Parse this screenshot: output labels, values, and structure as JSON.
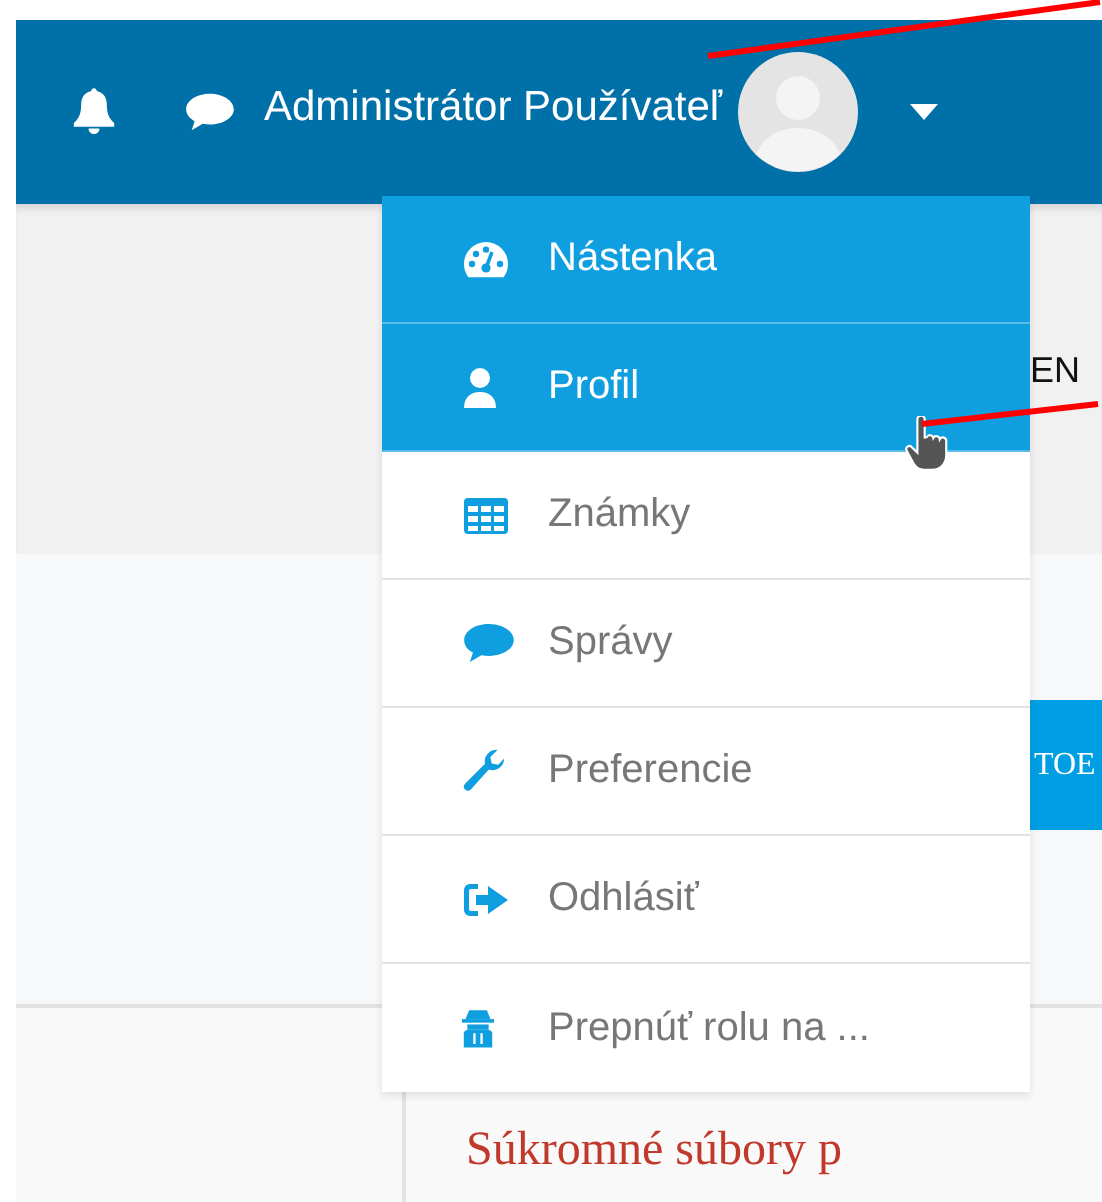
{
  "navbar": {
    "user_name": "Administrátor Používateľ"
  },
  "user_menu": {
    "expanded": true,
    "items": [
      {
        "label": "Nástenka",
        "kind": "dashboard",
        "highlighted": true
      },
      {
        "label": "Profil",
        "kind": "user",
        "highlighted": true
      },
      {
        "label": "Známky",
        "kind": "table",
        "highlighted": false
      },
      {
        "label": "Správy",
        "kind": "chat",
        "highlighted": false
      },
      {
        "label": "Preferencie",
        "kind": "wrench",
        "highlighted": false
      },
      {
        "label": "Odhlásiť",
        "kind": "signout",
        "highlighted": false
      },
      {
        "label": "Prepnúť rolu na ...",
        "kind": "spy",
        "highlighted": false
      }
    ]
  },
  "page": {
    "language": "EN",
    "button_text": "TOE",
    "heading": "Súkromné súbory p"
  }
}
